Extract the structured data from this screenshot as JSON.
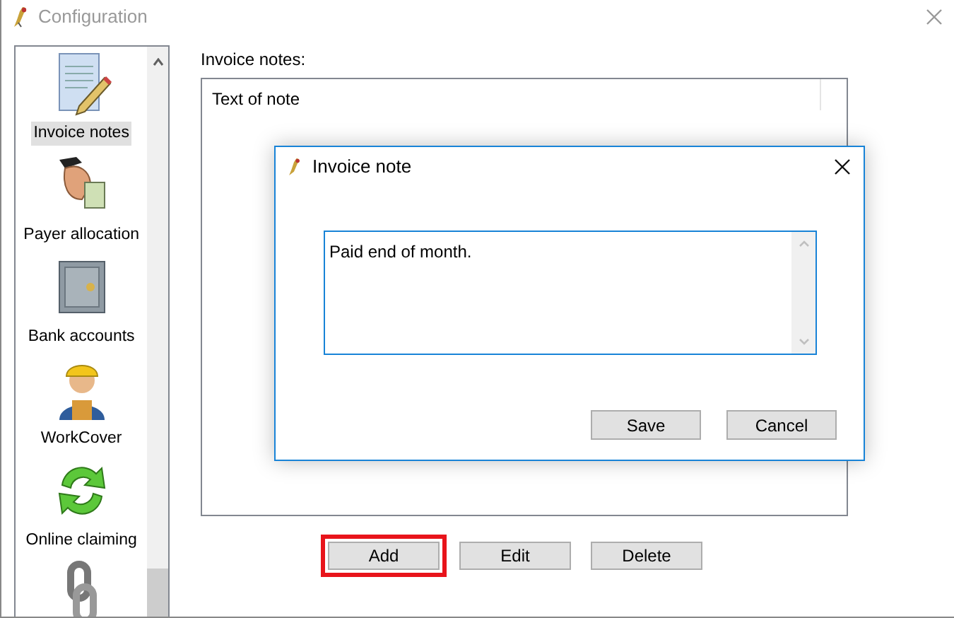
{
  "window": {
    "title": "Configuration",
    "active": false
  },
  "sidebar": {
    "items": [
      {
        "kind": "document",
        "label": "Invoice notes",
        "selected": true
      },
      {
        "kind": "hand",
        "label": "Payer allocation",
        "selected": false
      },
      {
        "kind": "safe",
        "label": "Bank accounts",
        "selected": false
      },
      {
        "kind": "worker",
        "label": "WorkCover",
        "selected": false
      },
      {
        "kind": "recycle",
        "label": "Online claiming",
        "selected": false
      },
      {
        "kind": "chain",
        "selected": false
      }
    ]
  },
  "notes_panel": {
    "label": "Invoice notes:",
    "columns": [
      "Text of note"
    ]
  },
  "buttons": [
    {
      "label": "Add",
      "highlighted": true
    },
    {
      "label": "Edit",
      "highlighted": false
    },
    {
      "label": "Delete",
      "highlighted": false
    }
  ],
  "dialog": {
    "title": "Invoice note",
    "note": "Paid end of month.",
    "buttons": [
      "Save",
      "Cancel"
    ]
  }
}
